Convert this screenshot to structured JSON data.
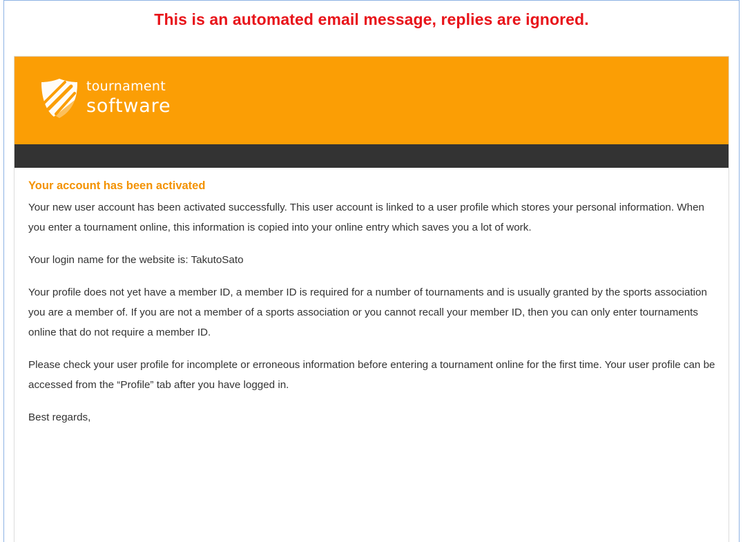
{
  "notice": "This is an automated email message, replies are ignored.",
  "brand": {
    "line1": "tournament",
    "line2": "software",
    "color": "#fb9e05",
    "dark_bar_color": "#333333"
  },
  "email": {
    "heading": "Your account has been activated",
    "paragraphs": [
      "Your new user account has been activated successfully. This user account is linked to a user profile which stores your personal information. When you enter a tournament online, this information is copied into your online entry which saves you a lot of work.",
      "Your login name for the website is: TakutoSato",
      "Your profile does not yet have a member ID, a member ID is required for a number of tournaments and is usually granted by the sports association you are a member of. If you are not a member of a sports association or you cannot recall your member ID, then you can only enter tournaments online that do not require a member ID.",
      "Please check your user profile for incomplete or erroneous information before entering a tournament online for the first time. Your user profile can be accessed from the “Profile” tab after you have logged in.",
      "Best regards,"
    ]
  },
  "icons": [
    "shield-logo-icon"
  ]
}
